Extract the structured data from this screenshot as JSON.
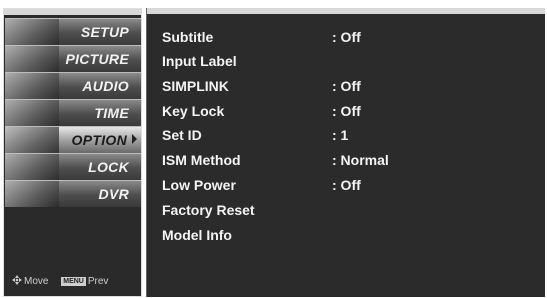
{
  "sidebar": {
    "items": [
      {
        "label": "SETUP",
        "active": false
      },
      {
        "label": "PICTURE",
        "active": false
      },
      {
        "label": "AUDIO",
        "active": false
      },
      {
        "label": "TIME",
        "active": false
      },
      {
        "label": "OPTION",
        "active": true
      },
      {
        "label": "LOCK",
        "active": false
      },
      {
        "label": "DVR",
        "active": false
      }
    ],
    "footer": {
      "move": "Move",
      "menu_key": "MENU",
      "prev": "Prev"
    }
  },
  "panel": {
    "rows": [
      {
        "label": "Subtitle",
        "value": ": Off"
      },
      {
        "label": "Input Label",
        "value": ""
      },
      {
        "label": "SIMPLINK",
        "value": ": Off"
      },
      {
        "label": "Key Lock",
        "value": ": Off"
      },
      {
        "label": "Set ID",
        "value": ": 1"
      },
      {
        "label": "ISM Method",
        "value": ": Normal"
      },
      {
        "label": "Low Power",
        "value": ": Off"
      },
      {
        "label": "Factory Reset",
        "value": ""
      },
      {
        "label": "Model Info",
        "value": ""
      }
    ]
  }
}
